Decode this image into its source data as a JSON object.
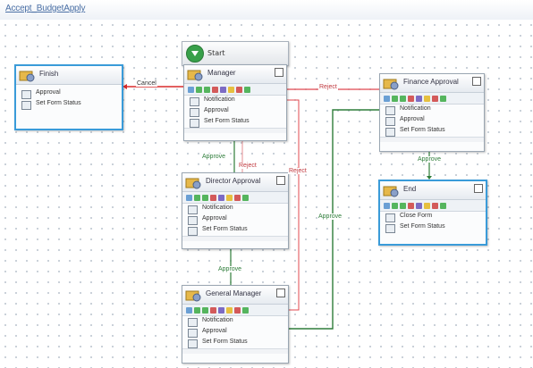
{
  "window": {
    "title": "Accept_BudgetApply"
  },
  "start": {
    "label": "Start"
  },
  "nodes": [
    {
      "id": "n-left",
      "name": "Finish",
      "rows": [
        "Approval",
        "Set Form Status"
      ]
    },
    {
      "id": "n-top",
      "name": "Manager",
      "rows": [
        "Notification",
        "Approval",
        "Set Form Status"
      ]
    },
    {
      "id": "n-mid",
      "name": "Director Approval",
      "rows": [
        "Notification",
        "Approval",
        "Set Form Status"
      ]
    },
    {
      "id": "n-bottom",
      "name": "General Manager",
      "rows": [
        "Notification",
        "Approval",
        "Set Form Status"
      ]
    },
    {
      "id": "n-right",
      "name": "Finance Approval",
      "rows": [
        "Notification",
        "Approval",
        "Set Form Status"
      ]
    },
    {
      "id": "n-end",
      "name": "End",
      "rows": [
        "Close Form",
        "Set Form Status"
      ]
    }
  ],
  "connections": {
    "to_finish": "Cancel",
    "reject_right": "Reject",
    "approve_down": "Approve",
    "reject_up": "Reject",
    "reject_long": "Reject",
    "approve_mid": "Approve",
    "approve_right": "Approve",
    "approve_end": "Approve"
  },
  "colors": {
    "approve_line": "#2e7d3a",
    "reject_line": "#e0484f",
    "cancel_line": "#d92b2b",
    "selected_border": "#3a9bd9"
  },
  "icons": [
    "play-icon",
    "folder-user-icon",
    "maximize-icon",
    "notification-icon",
    "approval-icon",
    "status-icon"
  ]
}
